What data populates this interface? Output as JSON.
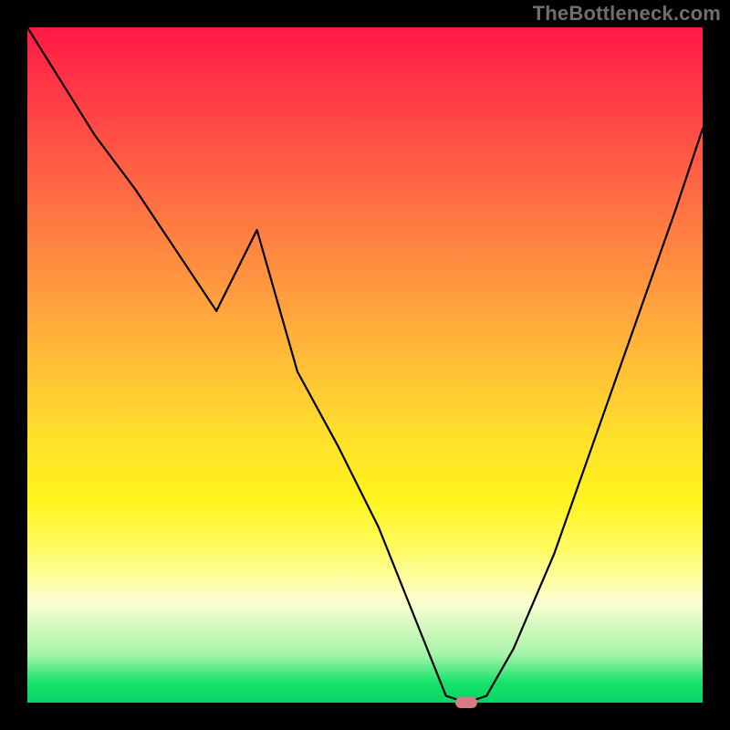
{
  "watermark": "TheBottleneck.com",
  "chart_data": {
    "type": "line",
    "title": "",
    "xlabel": "",
    "ylabel": "",
    "xlim": [
      0,
      100
    ],
    "ylim": [
      0,
      100
    ],
    "background": {
      "gradient": "vertical",
      "meaning": "bottleneck severity heatmap (red high, green low)",
      "stops": [
        {
          "pos": 0,
          "color": "#ff1a46"
        },
        {
          "pos": 50,
          "color": "#ffbf36"
        },
        {
          "pos": 75,
          "color": "#fffb60"
        },
        {
          "pos": 93,
          "color": "#a4f3a9"
        },
        {
          "pos": 100,
          "color": "#06d465"
        }
      ]
    },
    "series": [
      {
        "name": "bottleneck-curve",
        "color": "#000000",
        "x": [
          0,
          5,
          10,
          16,
          22,
          28,
          34,
          40,
          46,
          52,
          56,
          60,
          62,
          65,
          68,
          72,
          78,
          84,
          90,
          96,
          100
        ],
        "values": [
          100,
          92,
          84,
          76,
          67,
          58,
          70,
          49,
          38,
          26,
          16,
          6,
          1,
          0,
          1,
          8,
          22,
          39,
          56,
          73,
          85
        ]
      }
    ],
    "marker": {
      "name": "optimal-point",
      "x": 65,
      "y": 0,
      "color": "#d87a7f"
    }
  }
}
